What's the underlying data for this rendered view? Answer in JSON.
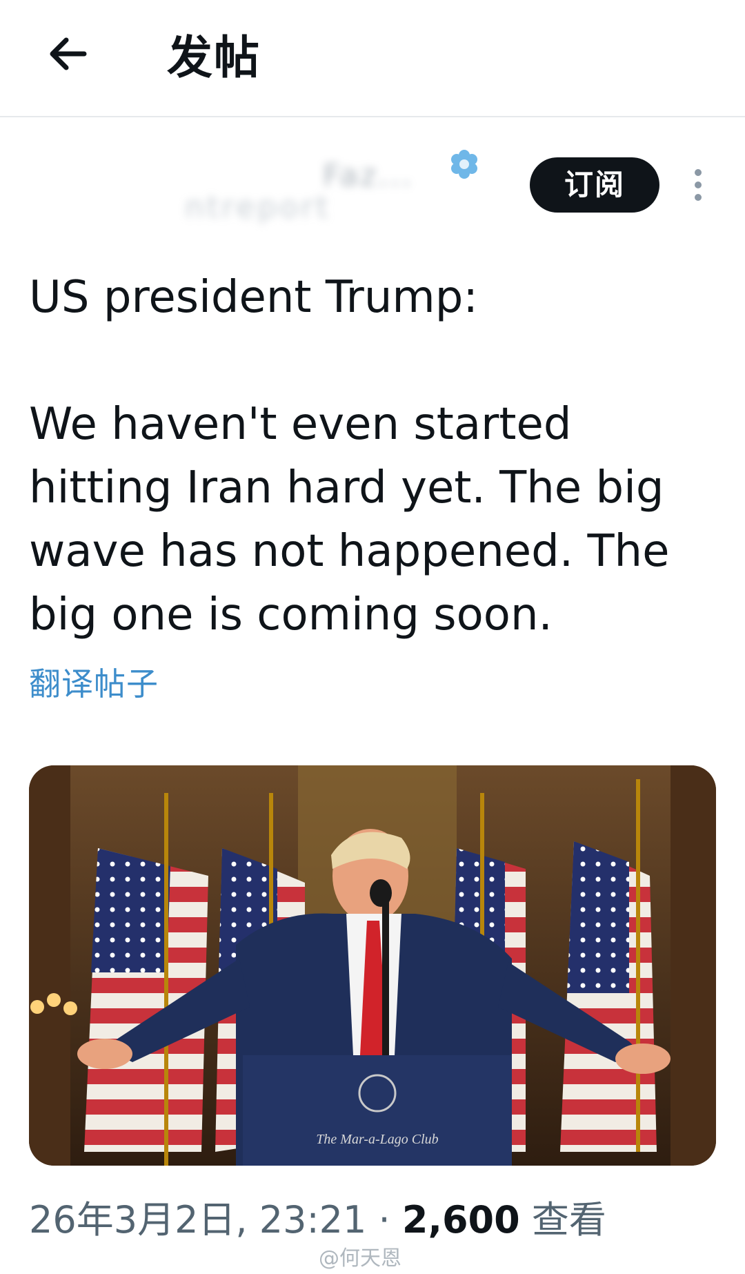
{
  "header": {
    "title": "发帖",
    "back_icon": "arrow-left-icon"
  },
  "post": {
    "author": {
      "name_blurred": "Faz...",
      "handle_blurred": "ntreport",
      "verified_icon": "verified-badge-icon"
    },
    "subscribe_label": "订阅",
    "more_icon": "more-vertical-icon",
    "text": "US president Trump:\n\nWe haven't even started hitting Iran hard yet. The big wave has not happened. The big one is coming soon.",
    "translate_label": "翻译帖子",
    "media_alt": "The Mar-a-Lago Club",
    "timestamp": "26年3月2日, 23:21 · ",
    "views_count": "2,600",
    "views_label": " 查看"
  },
  "watermark": "@何天恩",
  "colors": {
    "link": "#3d8dcb",
    "text": "#0f1419",
    "muted": "#536471",
    "subscribe_bg": "#0f1419"
  }
}
